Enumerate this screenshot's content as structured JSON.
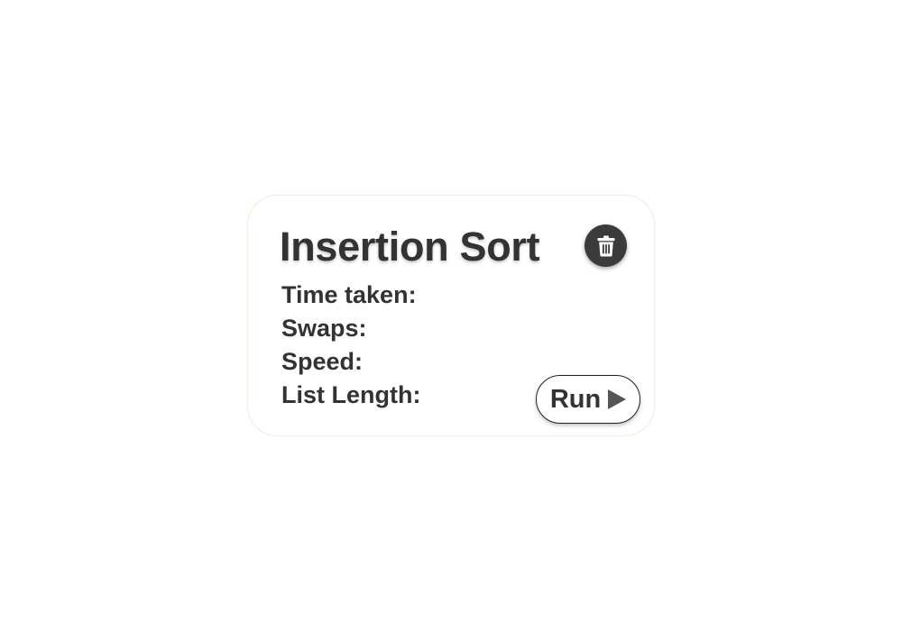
{
  "card": {
    "title": "Insertion Sort",
    "delete_icon": "trash-icon",
    "stats": [
      {
        "label": "Time taken:",
        "value": ""
      },
      {
        "label": "Swaps:",
        "value": ""
      },
      {
        "label": "Speed:",
        "value": ""
      },
      {
        "label": "List Length:",
        "value": ""
      }
    ],
    "run_button": {
      "label": "Run",
      "icon": "play-icon"
    }
  },
  "colors": {
    "text": "#333333",
    "delete_button_bg": "#3b3b3b",
    "play_icon": "#555555",
    "card_border": "#f3eddc"
  }
}
